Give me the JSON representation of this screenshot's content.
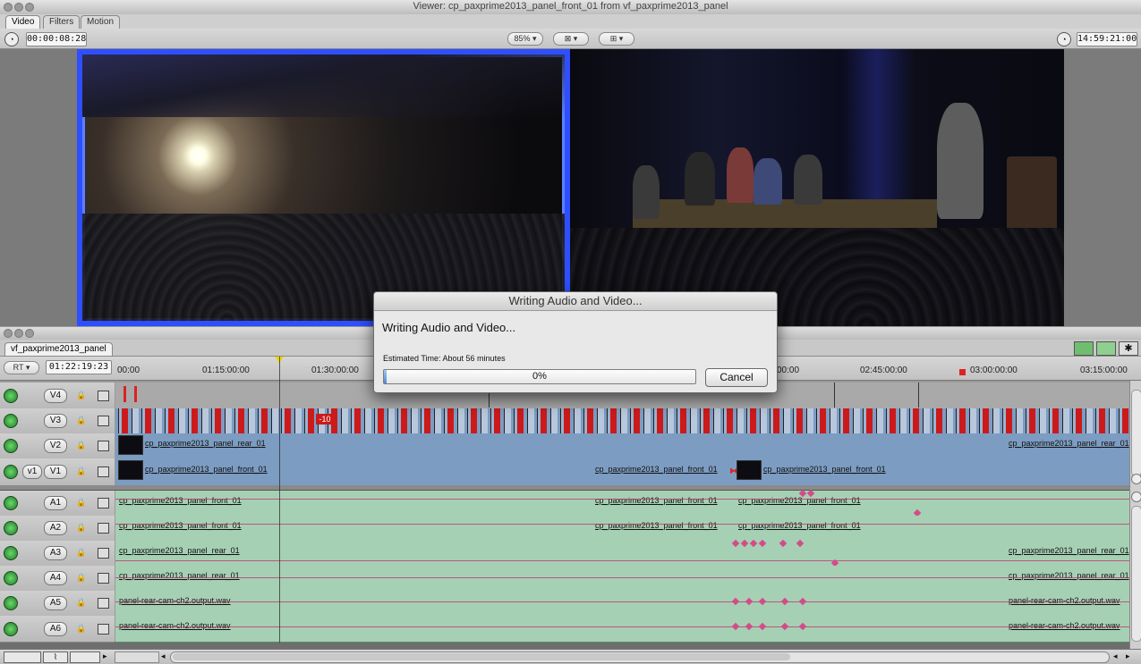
{
  "viewer": {
    "title": "Viewer: cp_paxprime2013_panel_front_01 from vf_paxprime2013_panel",
    "tabs": [
      "Video",
      "Filters",
      "Motion"
    ],
    "duration_tc": "00:00:08:28",
    "zoom": "85%",
    "view_mode_icon": "view-mode-icon",
    "overlay_icon": "overlay-icon",
    "current_tc": "14:59:21:00"
  },
  "timeline": {
    "sequence_tab": "vf_paxprime2013_panel",
    "rt_label": "RT",
    "current_tc": "01:22:19:23",
    "ruler_labels": [
      "00:00",
      "01:15:00:00",
      "01:30:00:00",
      "00:00",
      "02:45:00:00",
      "03:00:00:00",
      "03:15:00:00"
    ],
    "video_tracks": [
      {
        "name": "V4",
        "clips": []
      },
      {
        "name": "V3",
        "clips": []
      },
      {
        "name": "V2",
        "clips": [
          "cp_paxprime2013_panel_rear_01",
          "cp_paxprime2013_panel_rear_01"
        ]
      },
      {
        "name": "V1",
        "source": "v1",
        "clips": [
          "cp_paxprime2013_panel_front_01",
          "cp_paxprime2013_panel_front_01",
          "cp_paxprime2013_panel_front_01"
        ]
      }
    ],
    "audio_tracks": [
      {
        "name": "A1",
        "clips": [
          "cp_paxprime2013_panel_front_01",
          "cp_paxprime2013_panel_front_01",
          "cp_paxprime2013_panel_front_01"
        ]
      },
      {
        "name": "A2",
        "clips": [
          "cp_paxprime2013_panel_front_01",
          "cp_paxprime2013_panel_front_01",
          "cp_paxprime2013_panel_front_01"
        ]
      },
      {
        "name": "A3",
        "clips": [
          "cp_paxprime2013_panel_rear_01",
          "cp_paxprime2013_panel_rear_01"
        ]
      },
      {
        "name": "A4",
        "clips": [
          "cp_paxprime2013_panel_rear_01",
          "cp_paxprime2013_panel_rear_01"
        ]
      },
      {
        "name": "A5",
        "clips": [
          "panel-rear-cam-ch2.output.wav",
          "panel-rear-cam-ch2.output.wav"
        ]
      },
      {
        "name": "A6",
        "clips": [
          "panel-rear-cam-ch2.output.wav",
          "panel-rear-cam-ch2.output.wav"
        ]
      }
    ],
    "v3_marker": "-10"
  },
  "dialog": {
    "title": "Writing Audio and Video...",
    "message": "Writing Audio and Video...",
    "estimate": "Estimated Time: About 56 minutes",
    "progress_fraction": 0.0,
    "progress_label": "0%",
    "cancel_label": "Cancel"
  }
}
